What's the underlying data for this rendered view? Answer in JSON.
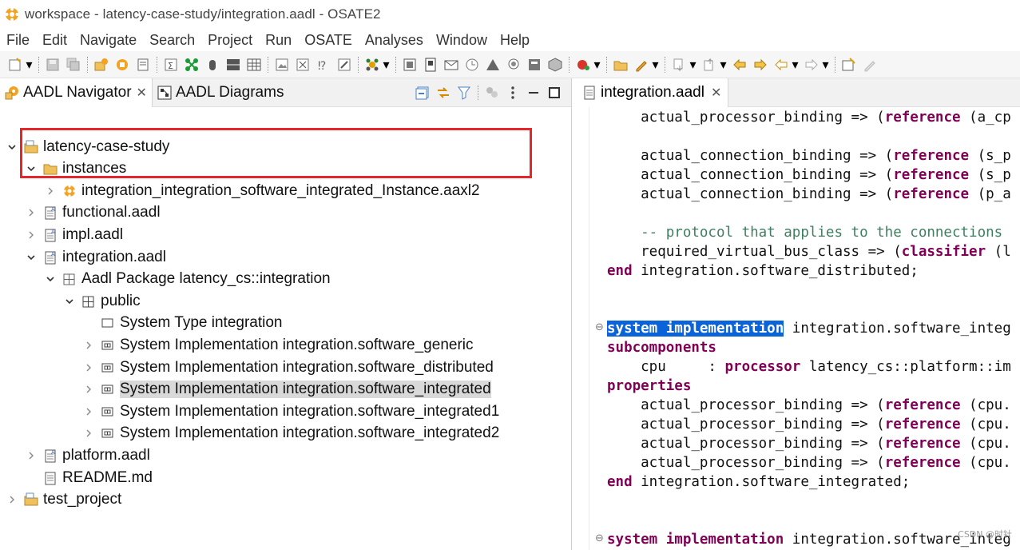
{
  "window": {
    "title": "workspace - latency-case-study/integration.aadl - OSATE2",
    "app_icon": "osate-gear-icon"
  },
  "menu": [
    "File",
    "Edit",
    "Navigate",
    "Search",
    "Project",
    "Run",
    "OSATE",
    "Analyses",
    "Window",
    "Help"
  ],
  "left_tabs": [
    {
      "label": "AADL Navigator",
      "icon": "aadl-navigator-icon",
      "closable": true,
      "active": true
    },
    {
      "label": "AADL Diagrams",
      "icon": "aadl-diagrams-icon",
      "closable": false,
      "active": false
    }
  ],
  "tree": [
    {
      "label": "latency-case-study",
      "icon": "project-folder-icon",
      "twisty": "expanded",
      "indent": 0
    },
    {
      "label": "instances",
      "icon": "folder-icon",
      "twisty": "expanded",
      "indent": 1
    },
    {
      "label": "integration_integration_software_integrated_Instance.aaxl2",
      "icon": "instance-model-icon",
      "twisty": "collapsed",
      "indent": 2
    },
    {
      "label": "functional.aadl",
      "icon": "aadl-file-icon",
      "twisty": "collapsed",
      "indent": 1
    },
    {
      "label": "impl.aadl",
      "icon": "aadl-file-icon",
      "twisty": "collapsed",
      "indent": 1
    },
    {
      "label": "integration.aadl",
      "icon": "aadl-file-icon",
      "twisty": "expanded",
      "indent": 1
    },
    {
      "label": "Aadl Package latency_cs::integration",
      "icon": "package-icon",
      "twisty": "expanded",
      "indent": 2
    },
    {
      "label": "public",
      "icon": "public-section-icon",
      "twisty": "expanded",
      "indent": 3
    },
    {
      "label": "System Type integration",
      "icon": "system-type-icon",
      "twisty": "none",
      "indent": 4
    },
    {
      "label": "System Implementation integration.software_generic",
      "icon": "system-impl-icon",
      "twisty": "collapsed",
      "indent": 4
    },
    {
      "label": "System Implementation integration.software_distributed",
      "icon": "system-impl-icon",
      "twisty": "collapsed",
      "indent": 4
    },
    {
      "label": "System Implementation integration.software_integrated",
      "icon": "system-impl-icon",
      "twisty": "collapsed",
      "indent": 4,
      "selected": true
    },
    {
      "label": "System Implementation integration.software_integrated1",
      "icon": "system-impl-icon",
      "twisty": "collapsed",
      "indent": 4
    },
    {
      "label": "System Implementation integration.software_integrated2",
      "icon": "system-impl-icon",
      "twisty": "collapsed",
      "indent": 4
    },
    {
      "label": "platform.aadl",
      "icon": "aadl-file-icon",
      "twisty": "collapsed",
      "indent": 1
    },
    {
      "label": "README.md",
      "icon": "text-file-icon",
      "twisty": "none",
      "indent": 1
    },
    {
      "label": "test_project",
      "icon": "project-folder-icon",
      "twisty": "collapsed",
      "indent": 0
    }
  ],
  "editor": {
    "tab_label": "integration.aadl",
    "tab_icon": "aadl-file-icon",
    "lines": [
      {
        "segments": [
          {
            "t": "    actual_processor_binding => (",
            "c": "n"
          },
          {
            "t": "reference",
            "c": "kw"
          },
          {
            "t": " (a_cp",
            "c": "n"
          }
        ]
      },
      {
        "segments": []
      },
      {
        "segments": [
          {
            "t": "    actual_connection_binding => (",
            "c": "n"
          },
          {
            "t": "reference",
            "c": "kw"
          },
          {
            "t": " (s_p",
            "c": "n"
          }
        ]
      },
      {
        "segments": [
          {
            "t": "    actual_connection_binding => (",
            "c": "n"
          },
          {
            "t": "reference",
            "c": "kw"
          },
          {
            "t": " (s_p",
            "c": "n"
          }
        ]
      },
      {
        "segments": [
          {
            "t": "    actual_connection_binding => (",
            "c": "n"
          },
          {
            "t": "reference",
            "c": "kw"
          },
          {
            "t": " (p_a",
            "c": "n"
          }
        ]
      },
      {
        "segments": []
      },
      {
        "segments": [
          {
            "t": "    -- protocol that applies to the connections",
            "c": "cm"
          }
        ]
      },
      {
        "segments": [
          {
            "t": "    required_virtual_bus_class => (",
            "c": "n"
          },
          {
            "t": "classifier",
            "c": "kw"
          },
          {
            "t": " (l",
            "c": "n"
          }
        ]
      },
      {
        "segments": [
          {
            "t": "end",
            "c": "kw"
          },
          {
            "t": " integration.software_distributed;",
            "c": "n"
          }
        ]
      },
      {
        "segments": []
      },
      {
        "segments": []
      },
      {
        "fold": true,
        "segments": [
          {
            "t": "system implementation",
            "c": "kwsel"
          },
          {
            "t": " integration.software_integ",
            "c": "n"
          }
        ]
      },
      {
        "segments": [
          {
            "t": "subcomponents",
            "c": "kw"
          }
        ]
      },
      {
        "segments": [
          {
            "t": "    cpu     : ",
            "c": "n"
          },
          {
            "t": "processor",
            "c": "kw"
          },
          {
            "t": " latency_cs::platform::im",
            "c": "n"
          }
        ]
      },
      {
        "segments": [
          {
            "t": "properties",
            "c": "kw"
          }
        ]
      },
      {
        "segments": [
          {
            "t": "    actual_processor_binding => (",
            "c": "n"
          },
          {
            "t": "reference",
            "c": "kw"
          },
          {
            "t": " (cpu.",
            "c": "n"
          }
        ]
      },
      {
        "segments": [
          {
            "t": "    actual_processor_binding => (",
            "c": "n"
          },
          {
            "t": "reference",
            "c": "kw"
          },
          {
            "t": " (cpu.",
            "c": "n"
          }
        ]
      },
      {
        "segments": [
          {
            "t": "    actual_processor_binding => (",
            "c": "n"
          },
          {
            "t": "reference",
            "c": "kw"
          },
          {
            "t": " (cpu.",
            "c": "n"
          }
        ]
      },
      {
        "segments": [
          {
            "t": "    actual_processor_binding => (",
            "c": "n"
          },
          {
            "t": "reference",
            "c": "kw"
          },
          {
            "t": " (cpu.",
            "c": "n"
          }
        ]
      },
      {
        "segments": [
          {
            "t": "end",
            "c": "kw"
          },
          {
            "t": " integration.software_integrated;",
            "c": "n"
          }
        ]
      },
      {
        "segments": []
      },
      {
        "segments": []
      },
      {
        "fold": true,
        "segments": [
          {
            "t": "system implementation",
            "c": "kw"
          },
          {
            "t": " integration.software_integ",
            "c": "n"
          }
        ]
      }
    ]
  },
  "watermark": "CSDN @时针"
}
